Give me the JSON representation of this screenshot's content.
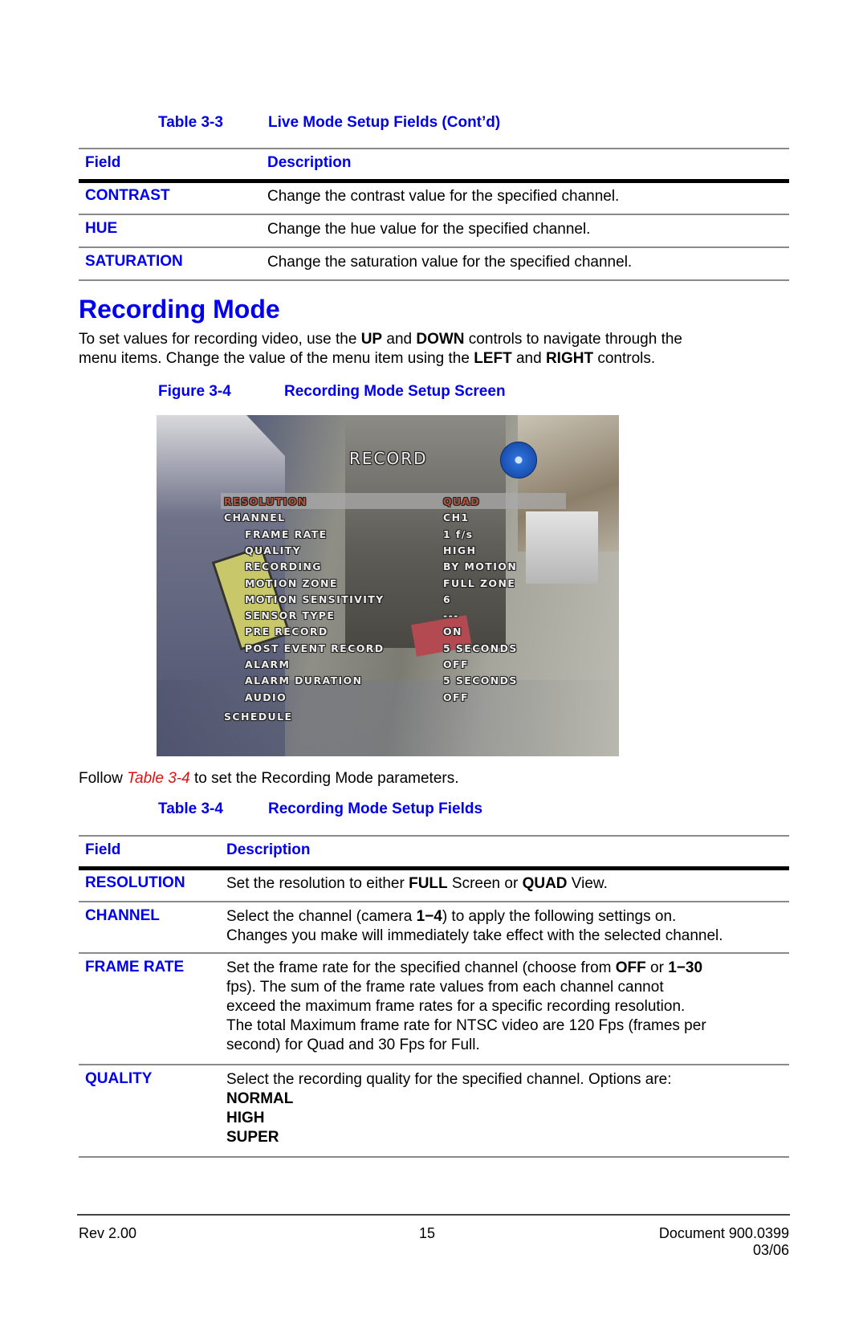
{
  "table_3_3": {
    "number": "Table 3-3",
    "title": "Live Mode Setup Fields  (Cont’d)",
    "headers": {
      "field": "Field",
      "description": "Description"
    },
    "rows": [
      {
        "field": "CONTRAST",
        "description": "Change the contrast value for the specified channel."
      },
      {
        "field": "HUE",
        "description": "Change the hue value for the specified channel."
      },
      {
        "field": "SATURATION",
        "description": "Change the saturation value for the specified channel."
      }
    ]
  },
  "section": {
    "heading": "Recording Mode",
    "intro": {
      "line1_a": "To set values for recording video, use the ",
      "line1_b": "UP",
      "line1_c": " and ",
      "line1_d": "DOWN",
      "line1_e": " controls to navigate through the",
      "line2_a": "menu items. Change the value of the menu item using the ",
      "line2_b": "LEFT",
      "line2_c": " and ",
      "line2_d": "RIGHT",
      "line2_e": " controls."
    }
  },
  "figure": {
    "number": "Figure 3-4",
    "title": "Recording Mode Setup Screen",
    "osd": {
      "title": "RECORD",
      "items": [
        {
          "label": "RESOLUTION",
          "value": "QUAD",
          "selected": true
        },
        {
          "label": "CHANNEL",
          "value": "CH1"
        },
        {
          "label": "FRAME RATE",
          "value": "1 f/s"
        },
        {
          "label": "QUALITY",
          "value": "HIGH"
        },
        {
          "label": "RECORDING",
          "value": "BY MOTION"
        },
        {
          "label": "MOTION ZONE",
          "value": "FULL ZONE"
        },
        {
          "label": "MOTION SENSITIVITY",
          "value": "6"
        },
        {
          "label": "SENSOR TYPE",
          "value": "---"
        },
        {
          "label": "PRE RECORD",
          "value": "ON"
        },
        {
          "label": "POST EVENT RECORD",
          "value": "5 SECONDS"
        },
        {
          "label": "ALARM",
          "value": "OFF"
        },
        {
          "label": "ALARM DURATION",
          "value": "5 SECONDS"
        },
        {
          "label": "AUDIO",
          "value": "OFF"
        },
        {
          "label": "SCHEDULE",
          "value": ""
        }
      ]
    }
  },
  "follow": {
    "prefix": "Follow ",
    "link": "Table 3-4",
    "suffix": " to set the Recording Mode parameters."
  },
  "table_3_4": {
    "number": "Table 3-4",
    "title": "Recording Mode Setup Fields",
    "headers": {
      "field": "Field",
      "description": "Description"
    },
    "resolution": {
      "field": "RESOLUTION",
      "a": "Set the resolution to either ",
      "b": "FULL",
      "c": " Screen or ",
      "d": "QUAD",
      "e": " View."
    },
    "channel": {
      "field": "CHANNEL",
      "a": "Select the channel (camera ",
      "b": "1−4",
      "c": ") to apply the following settings on.",
      "line2": "Changes you make will immediately take effect with the selected channel."
    },
    "frame_rate": {
      "field": "FRAME RATE",
      "a": "Set the frame rate for the specified channel (choose from ",
      "b": "OFF",
      "c": " or ",
      "d": "1−30",
      "line2": "fps). The sum of the frame rate values from each channel cannot",
      "line3": "exceed the maximum frame rates for a specific recording resolution.",
      "line4": "The total Maximum frame rate for NTSC video are 120 Fps (frames per",
      "line5": "second) for Quad and 30 Fps for Full."
    },
    "quality": {
      "field": "QUALITY",
      "line1": "Select the recording quality for the specified channel. Options are:",
      "options": [
        "NORMAL",
        "HIGH",
        "SUPER"
      ]
    }
  },
  "footer": {
    "rev": "Rev 2.00",
    "page": "15",
    "document": "Document 900.0399",
    "date": "03/06"
  }
}
